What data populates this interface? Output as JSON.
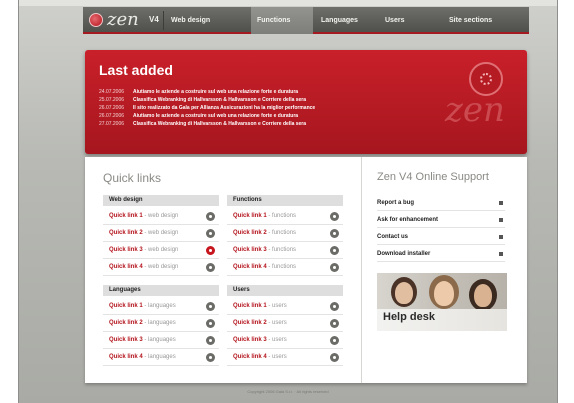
{
  "nav": {
    "logo_text": "zen",
    "version": "V4",
    "items": [
      {
        "label": "Web design"
      },
      {
        "label": "Functions"
      },
      {
        "label": "Languages"
      },
      {
        "label": "Users"
      },
      {
        "label": "Site sections"
      }
    ],
    "active_index": 1
  },
  "hero": {
    "title": "Last added",
    "watermark": "zen",
    "news": [
      {
        "date": "24.07.2006",
        "text": "Aiutiamo le aziende a costruire sul web una relazione forte e duratura"
      },
      {
        "date": "25.07.2006",
        "text": "Classifica Webranking di Hallvarsson & Hallvarsson e Corriere della sera"
      },
      {
        "date": "26.07.2006",
        "text": "Il sito realizzato da Gala per Allianza Assicurazioni ha la miglior performance"
      },
      {
        "date": "26.07.2006",
        "text": "Aiutiamo le aziende a costruire sul web una relazione forte e duratura"
      },
      {
        "date": "27.07.2006",
        "text": "Classifica Webranking di Hallvarsson & Hallvarsson e Corriere della sera"
      }
    ]
  },
  "quick_links": {
    "title": "Quick links",
    "groups": [
      {
        "heading": "Web design",
        "items": [
          {
            "link": "Quick link 1",
            "desc": "web design"
          },
          {
            "link": "Quick link 2",
            "desc": "web design"
          },
          {
            "link": "Quick link 3",
            "desc": "web design"
          },
          {
            "link": "Quick link 4",
            "desc": "web design"
          }
        ]
      },
      {
        "heading": "Functions",
        "items": [
          {
            "link": "Quick link 1",
            "desc": "functions"
          },
          {
            "link": "Quick link 2",
            "desc": "functions"
          },
          {
            "link": "Quick link 3",
            "desc": "functions"
          },
          {
            "link": "Quick link 4",
            "desc": "functions"
          }
        ]
      },
      {
        "heading": "Languages",
        "items": [
          {
            "link": "Quick link 1",
            "desc": "languages"
          },
          {
            "link": "Quick link 2",
            "desc": "languages"
          },
          {
            "link": "Quick link 3",
            "desc": "languages"
          },
          {
            "link": "Quick link 4",
            "desc": "languages"
          }
        ]
      },
      {
        "heading": "Users",
        "items": [
          {
            "link": "Quick link 1",
            "desc": "users"
          },
          {
            "link": "Quick link 2",
            "desc": "users"
          },
          {
            "link": "Quick link 3",
            "desc": "users"
          },
          {
            "link": "Quick link 4",
            "desc": "users"
          }
        ]
      }
    ]
  },
  "support": {
    "title": "Zen V4 Online Support",
    "items": [
      {
        "label": "Report a bug"
      },
      {
        "label": "Ask for enhancement"
      },
      {
        "label": "Contact us"
      },
      {
        "label": "Download installer"
      }
    ],
    "helpdesk_label": "Help desk"
  },
  "footer": {
    "copyright": "Copyright 2006 Gala S.r.l. · All rights reserved"
  },
  "colors": {
    "accent": "#b3121b",
    "nav_bg": "#5a5b56",
    "panel_bg": "#ffffff"
  }
}
